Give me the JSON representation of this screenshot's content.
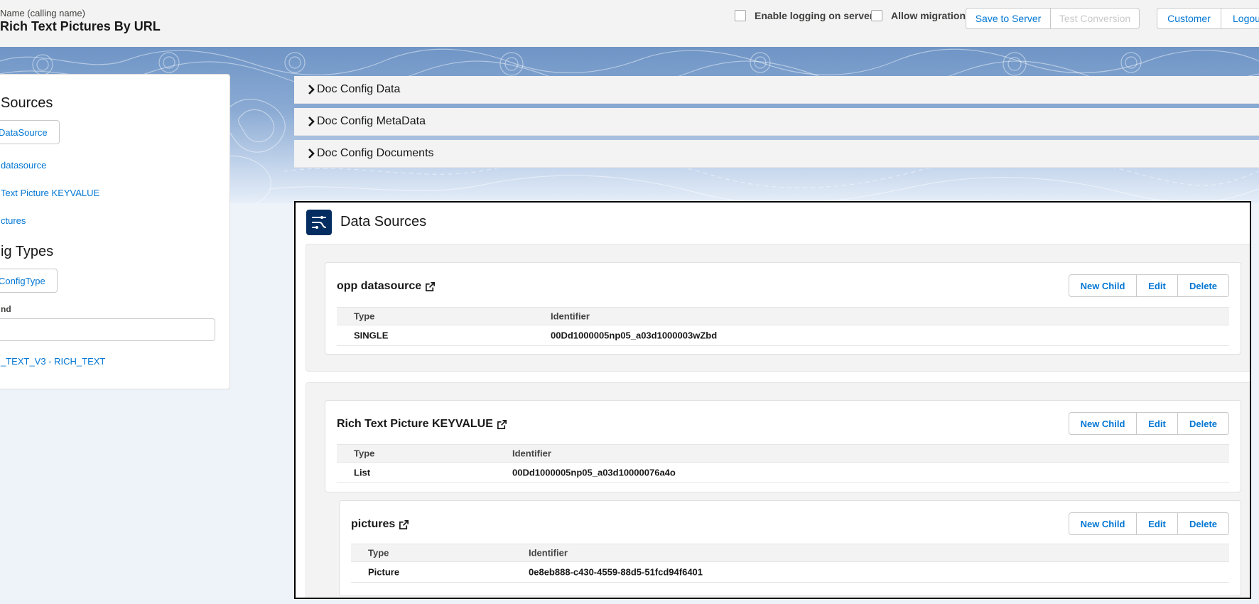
{
  "header": {
    "record_label": "Name (calling name)",
    "record_title": "Rich Text Pictures By URL",
    "enable_logging_label": "Enable logging on server",
    "allow_migration_label": "Allow migration",
    "save_label": "Save to Server",
    "test_label": "Test Conversion",
    "customer_label": "Customer",
    "logout_label": "Logout"
  },
  "left_panel": {
    "sources_heading": "Sources",
    "new_datasource_btn": "DataSource",
    "links": [
      "datasource",
      "Text Picture KEYVALUE",
      "ctures"
    ],
    "config_heading": "ig Types",
    "new_configtype_btn": "ConfigType",
    "find_label": "nd",
    "find_value": "",
    "config_links": [
      "_TEXT_V3 - RICH_TEXT"
    ]
  },
  "accordions": [
    {
      "label": "Doc Config Data"
    },
    {
      "label": "Doc Config MetaData"
    },
    {
      "label": "Doc Config Documents"
    }
  ],
  "data_sources": {
    "title": "Data Sources",
    "col_type": "Type",
    "col_identifier": "Identifier",
    "btn_new_child": "New Child",
    "btn_edit": "Edit",
    "btn_delete": "Delete",
    "nodes": [
      {
        "name": "opp datasource",
        "type": "SINGLE",
        "identifier": "00Dd1000005np05_a03d1000003wZbd"
      },
      {
        "name": "Rich Text Picture KEYVALUE",
        "type": "List",
        "identifier": "00Dd1000005np05_a03d10000076a4o"
      },
      {
        "name": "pictures",
        "type": "Picture",
        "identifier": "0e8eb888-c430-4559-88d5-51fcd94f6401"
      }
    ]
  },
  "colors": {
    "link": "#0176d3",
    "icon_bg": "#032d60",
    "banner": "#7f9fcc"
  }
}
